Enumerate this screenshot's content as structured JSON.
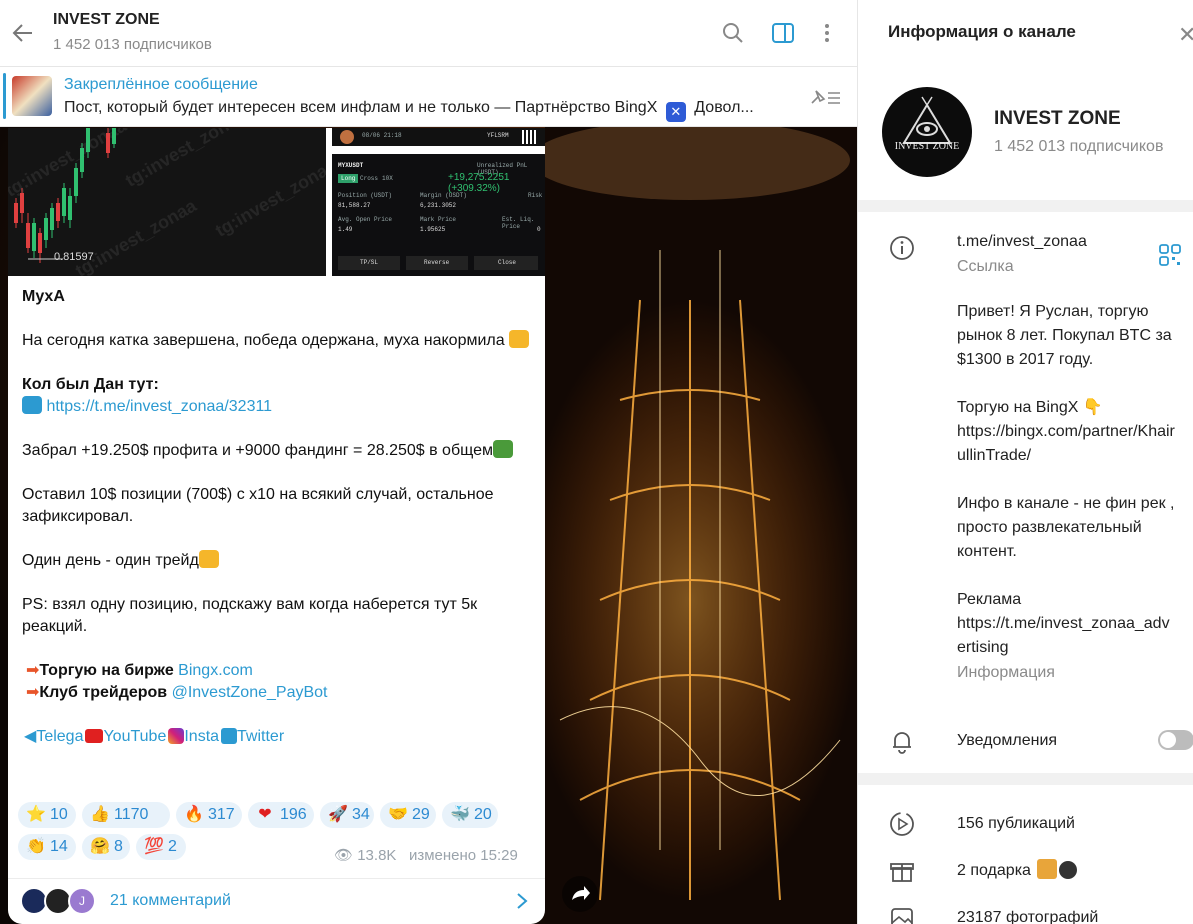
{
  "chat": {
    "title": "INVEST ZONE",
    "subscribers": "1 452 013 подписчиков"
  },
  "pinned": {
    "title": "Закреплённое сообщение",
    "text": "Пост, который будет интересен всем инфлам и не только — Партнёрство BingX",
    "text_tail": "Довол..."
  },
  "media": {
    "chart_price": "0.81597",
    "watermark": "tg:invest_zonaa",
    "top_date": "08/06 21:18",
    "top_user": "YFLSRM",
    "symbol": "MYXUSDT",
    "pnl_label": "Unrealized PnL (USDT)",
    "pnl": "+19,275.2251 (+309.32%)",
    "tag_long": "Long",
    "tag_cross": "Cross",
    "tag_lev": "10X",
    "position_label": "Position (USDT)",
    "position": "81,588.27",
    "margin_label": "Margin (USDT)",
    "margin": "6,231.3052",
    "risk_label": "Risk",
    "avg_label": "Avg. Open Price",
    "avg": "1.49",
    "mark_label": "Mark Price",
    "mark": "1.95625",
    "liq_label": "Est. Liq. Price",
    "liq": "0",
    "btn_tpsl": "TP/SL",
    "btn_reverse": "Reverse",
    "btn_close": "Close"
  },
  "message": {
    "heading": "МухА",
    "p1": "На сегодня катка завершена, победа одержана, муха накормила",
    "call_label": "Кол был Дан тут:",
    "call_link": "https://t.me/invest_zonaa/32311",
    "profit": "Забрал +19.250$ профита и  +9000 фандинг = 28.250$ в общем",
    "left_pos": "Оставил 10$ позиции (700$) с х10 на всякий случай, остальное зафиксировал.",
    "one_day": "Один день - один трейд",
    "ps": "PS: взял одну позицию, подскажу вам когда наберется тут 5к реакций.",
    "trade_label": "Торгую на бирже",
    "trade_link": "Bingx.com",
    "club_label": "Клуб трейдеров",
    "club_link": "@InvestZone_PayBot",
    "soc_telega": "Telega",
    "soc_youtube": "YouTube",
    "soc_insta": "Insta",
    "soc_twitter": "Twitter"
  },
  "reactions": [
    {
      "icon": "⭐",
      "count": "10"
    },
    {
      "icon": "👍",
      "count": "1170"
    },
    {
      "icon": "🔥",
      "count": "317"
    },
    {
      "icon": "❤",
      "count": "196"
    },
    {
      "icon": "🚀",
      "count": "34"
    },
    {
      "icon": "🤝",
      "count": "29"
    },
    {
      "icon": "🐳",
      "count": "20"
    },
    {
      "icon": "👏",
      "count": "14"
    },
    {
      "icon": "🤗",
      "count": "8"
    },
    {
      "icon": "💯",
      "count": "2"
    }
  ],
  "meta": {
    "views": "13.8K",
    "edited": "изменено 15:29"
  },
  "comments": {
    "label": "21 комментарий",
    "avatar_letter": "J"
  },
  "info": {
    "title": "Информация о канале",
    "avatar_text": "INVEST ZONE",
    "name": "INVEST ZONE",
    "subscribers": "1 452 013 подписчиков",
    "link": "t.me/invest_zonaa",
    "link_label": "Ссылка",
    "desc1": "Привет! Я Руслан, торгую рынок 8 лет. Покупал BTC за $1300 в 2017 году.",
    "desc2": "Торгую на BingX 👇",
    "desc2_link": "https://bingx.com/partner/KhairullinTrade/",
    "desc3": "Инфо в канале - не фин рек , просто развлекательный контент.",
    "desc4": "Реклама",
    "desc4_link": "https://t.me/invest_zonaa_advertising",
    "info_label": "Информация",
    "notifications": "Уведомления",
    "publications": "156 публикаций",
    "gifts": "2 подарка",
    "photos": "23187 фотографий"
  },
  "colors": {
    "accent": "#2c9ad1",
    "reaction_bg": "#e8f2fa"
  }
}
